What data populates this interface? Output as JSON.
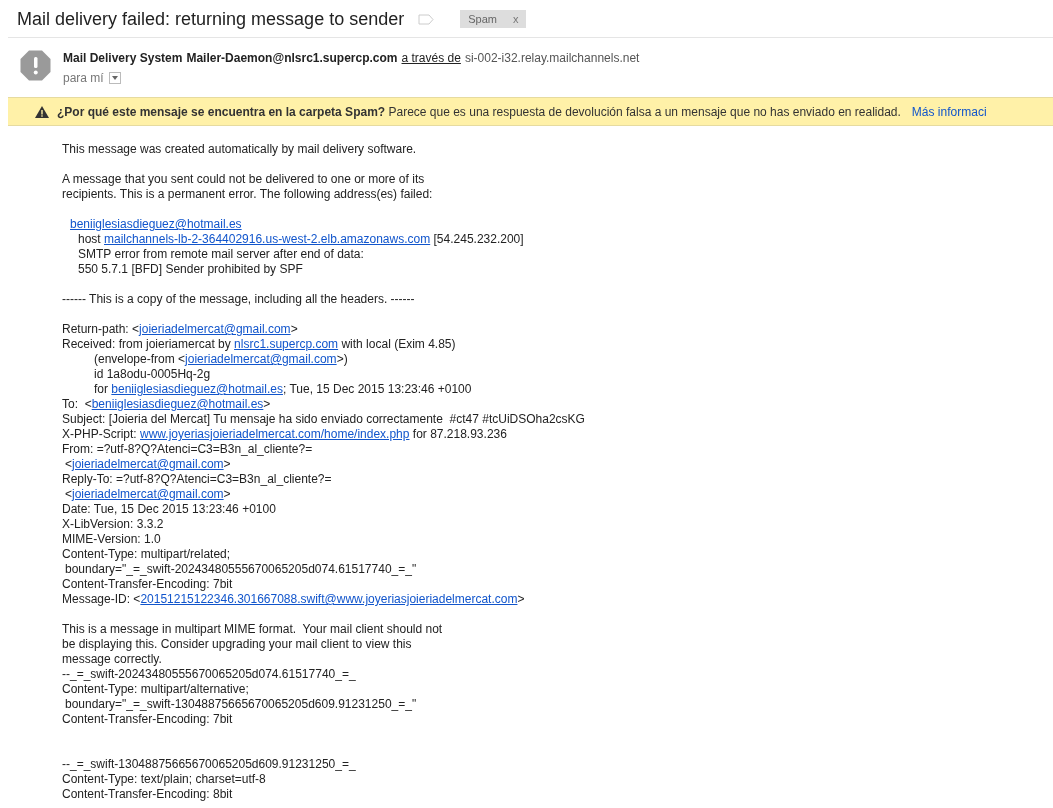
{
  "subject": {
    "title": "Mail delivery failed: returning message to sender",
    "label_chip": {
      "text": "Spam",
      "remove": "x"
    }
  },
  "sender": {
    "name": "Mail Delivery System",
    "address": "Mailer-Daemon@nlsrc1.supercp.com",
    "via_label": "a través de",
    "via_host": "si-002-i32.relay.mailchannels.net",
    "recipient": "para mí"
  },
  "spam_banner": {
    "question": "¿Por qué este mensaje se encuentra en la carpeta Spam?",
    "explanation": "Parece que es una respuesta de devolución falsa a un mensaje que no has enviado en realidad.",
    "link": "Más informaci"
  },
  "body": [
    {
      "kind": "flush",
      "parts": [
        {
          "text": "This message was created automatically by mail delivery software.",
          "kind": "text"
        }
      ]
    },
    {
      "kind": "gap"
    },
    {
      "kind": "flush",
      "parts": [
        {
          "text": "A message that you sent could not be delivered to one or more of its",
          "kind": "text"
        }
      ]
    },
    {
      "kind": "flush",
      "parts": [
        {
          "text": "recipients. This is a permanent error. The following address(es) failed:",
          "kind": "text"
        }
      ]
    },
    {
      "kind": "gap"
    },
    {
      "kind": "shallow",
      "parts": [
        {
          "text": "beniiglesiasdieguez@hotmail.es",
          "kind": "link"
        }
      ]
    },
    {
      "kind": "mid",
      "parts": [
        {
          "text": "host ",
          "kind": "text"
        },
        {
          "text": "mailchannels-lb-2-364402916.us-west-2.elb.amazonaws.com",
          "kind": "link"
        },
        {
          "text": " [54.245.232.200]",
          "kind": "text"
        }
      ]
    },
    {
      "kind": "mid",
      "parts": [
        {
          "text": "SMTP error from remote mail server after end of data:",
          "kind": "text"
        }
      ]
    },
    {
      "kind": "mid",
      "parts": [
        {
          "text": "550 5.7.1 [BFD] Sender prohibited by SPF",
          "kind": "text"
        }
      ]
    },
    {
      "kind": "gap"
    },
    {
      "kind": "flush",
      "parts": [
        {
          "text": "------ This is a copy of the message, including all the headers. ------",
          "kind": "text"
        }
      ]
    },
    {
      "kind": "gap"
    },
    {
      "kind": "flush",
      "parts": [
        {
          "text": "Return-path: <",
          "kind": "text"
        },
        {
          "text": "joieriadelmercat@gmail.com",
          "kind": "link"
        },
        {
          "text": ">",
          "kind": "text"
        }
      ]
    },
    {
      "kind": "flush",
      "parts": [
        {
          "text": "Received: from joieriamercat by ",
          "kind": "text"
        },
        {
          "text": "nlsrc1.supercp.com",
          "kind": "link"
        },
        {
          "text": " with local (Exim 4.85)",
          "kind": "text"
        }
      ]
    },
    {
      "kind": "deep",
      "parts": [
        {
          "text": "(envelope-from <",
          "kind": "text"
        },
        {
          "text": "joieriadelmercat@gmail.com",
          "kind": "link"
        },
        {
          "text": ">)",
          "kind": "text"
        }
      ]
    },
    {
      "kind": "deep",
      "parts": [
        {
          "text": "id 1a8odu-0005Hq-2g",
          "kind": "text"
        }
      ]
    },
    {
      "kind": "deep",
      "parts": [
        {
          "text": "for ",
          "kind": "text"
        },
        {
          "text": "beniiglesiasdieguez@hotmail.es",
          "kind": "link"
        },
        {
          "text": "; Tue, 15 Dec 2015 13:23:46 +0100",
          "kind": "text"
        }
      ]
    },
    {
      "kind": "flush",
      "parts": [
        {
          "text": "To:  <",
          "kind": "text"
        },
        {
          "text": "beniiglesiasdieguez@hotmail.es",
          "kind": "link"
        },
        {
          "text": ">",
          "kind": "text"
        }
      ]
    },
    {
      "kind": "flush",
      "parts": [
        {
          "text": "Subject: [Joieria del Mercat] Tu mensaje ha sido enviado correctamente  #ct47 #tcUiDSOha2csKG",
          "kind": "text"
        }
      ]
    },
    {
      "kind": "flush",
      "parts": [
        {
          "text": "X-PHP-Script: ",
          "kind": "text"
        },
        {
          "text": "www.joyeriasjoieriadelmercat.com/home/index.php",
          "kind": "link"
        },
        {
          "text": " for 87.218.93.236",
          "kind": "text"
        }
      ]
    },
    {
      "kind": "flush",
      "parts": [
        {
          "text": "From: =?utf-8?Q?Atenci=C3=B3n_al_cliente?=",
          "kind": "text"
        }
      ]
    },
    {
      "kind": "nudge",
      "parts": [
        {
          "text": "<",
          "kind": "text"
        },
        {
          "text": "joieriadelmercat@gmail.com",
          "kind": "link"
        },
        {
          "text": ">",
          "kind": "text"
        }
      ]
    },
    {
      "kind": "flush",
      "parts": [
        {
          "text": "Reply-To: =?utf-8?Q?Atenci=C3=B3n_al_cliente?=",
          "kind": "text"
        }
      ]
    },
    {
      "kind": "nudge",
      "parts": [
        {
          "text": "<",
          "kind": "text"
        },
        {
          "text": "joieriadelmercat@gmail.com",
          "kind": "link"
        },
        {
          "text": ">",
          "kind": "text"
        }
      ]
    },
    {
      "kind": "flush",
      "parts": [
        {
          "text": "Date: Tue, 15 Dec 2015 13:23:46 +0100",
          "kind": "text"
        }
      ]
    },
    {
      "kind": "flush",
      "parts": [
        {
          "text": "X-LibVersion: 3.3.2",
          "kind": "text"
        }
      ]
    },
    {
      "kind": "flush",
      "parts": [
        {
          "text": "MIME-Version: 1.0",
          "kind": "text"
        }
      ]
    },
    {
      "kind": "flush",
      "parts": [
        {
          "text": "Content-Type: multipart/related;",
          "kind": "text"
        }
      ]
    },
    {
      "kind": "nudge",
      "parts": [
        {
          "text": "boundary=\"_=_swift-20243480555670065205d074.61517740_=_\"",
          "kind": "text"
        }
      ]
    },
    {
      "kind": "flush",
      "parts": [
        {
          "text": "Content-Transfer-Encoding: 7bit",
          "kind": "text"
        }
      ]
    },
    {
      "kind": "flush",
      "parts": [
        {
          "text": "Message-ID: <",
          "kind": "text"
        },
        {
          "text": "20151215122346.301667088.swift@www.joyeriasjoieriadelmercat.com",
          "kind": "link"
        },
        {
          "text": ">",
          "kind": "text"
        }
      ]
    },
    {
      "kind": "gap"
    },
    {
      "kind": "flush",
      "parts": [
        {
          "text": "This is a message in multipart MIME format.  Your mail client should not",
          "kind": "text"
        }
      ]
    },
    {
      "kind": "flush",
      "parts": [
        {
          "text": "be displaying this. Consider upgrading your mail client to view this",
          "kind": "text"
        }
      ]
    },
    {
      "kind": "flush",
      "parts": [
        {
          "text": "message correctly.",
          "kind": "text"
        }
      ]
    },
    {
      "kind": "flush",
      "parts": [
        {
          "text": "--_=_swift-20243480555670065205d074.61517740_=_",
          "kind": "text"
        }
      ]
    },
    {
      "kind": "flush",
      "parts": [
        {
          "text": "Content-Type: multipart/alternative;",
          "kind": "text"
        }
      ]
    },
    {
      "kind": "nudge",
      "parts": [
        {
          "text": "boundary=\"_=_swift-13048875665670065205d609.91231250_=_\"",
          "kind": "text"
        }
      ]
    },
    {
      "kind": "flush",
      "parts": [
        {
          "text": "Content-Transfer-Encoding: 7bit",
          "kind": "text"
        }
      ]
    },
    {
      "kind": "gap"
    },
    {
      "kind": "gap"
    },
    {
      "kind": "flush",
      "parts": [
        {
          "text": "--_=_swift-13048875665670065205d609.91231250_=_",
          "kind": "text"
        }
      ]
    },
    {
      "kind": "flush",
      "parts": [
        {
          "text": "Content-Type: text/plain; charset=utf-8",
          "kind": "text"
        }
      ]
    },
    {
      "kind": "flush",
      "parts": [
        {
          "text": "Content-Transfer-Encoding: 8bit",
          "kind": "text"
        }
      ]
    }
  ]
}
